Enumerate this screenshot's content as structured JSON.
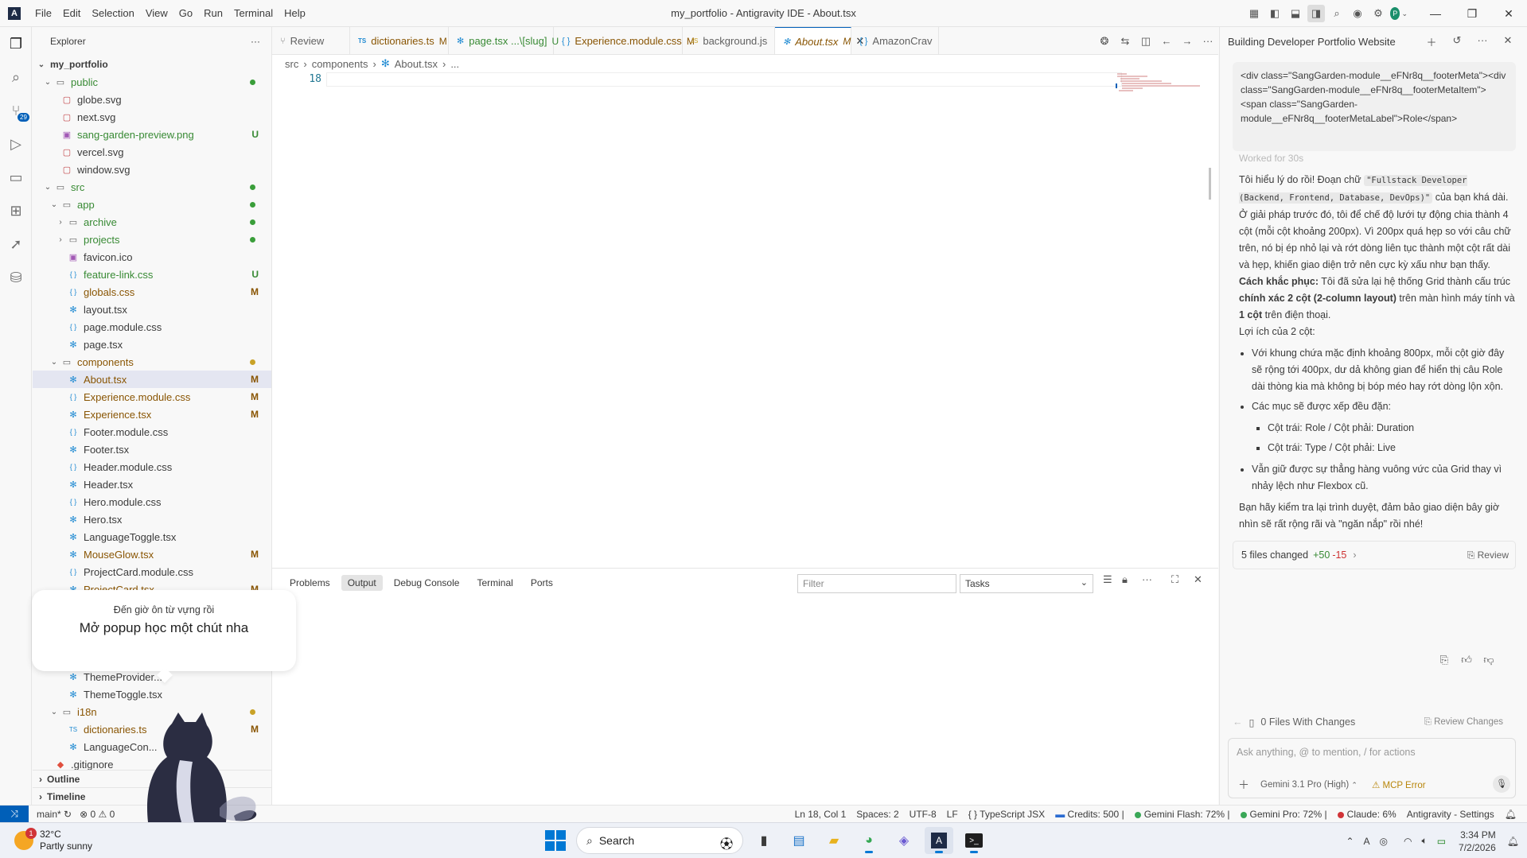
{
  "titlebar": {
    "menu": [
      "File",
      "Edit",
      "Selection",
      "View",
      "Go",
      "Run",
      "Terminal",
      "Help"
    ],
    "title": "my_portfolio - Antigravity IDE - About.tsx",
    "avatar": "P"
  },
  "activity": {
    "scm_badge": "29"
  },
  "explorer": {
    "title": "Explorer",
    "root": "my_portfolio",
    "rows": [
      {
        "name": "public",
        "kind": "folder-open",
        "depth": 1,
        "dot": "#3a9e3a",
        "color": "#388a34"
      },
      {
        "name": "globe.svg",
        "kind": "svg",
        "depth": 2
      },
      {
        "name": "next.svg",
        "kind": "svg",
        "depth": 2
      },
      {
        "name": "sang-garden-preview.png",
        "kind": "png",
        "depth": 2,
        "badge": "U",
        "color": "#388a34"
      },
      {
        "name": "vercel.svg",
        "kind": "svg",
        "depth": 2
      },
      {
        "name": "window.svg",
        "kind": "svg",
        "depth": 2
      },
      {
        "name": "src",
        "kind": "folder-open",
        "depth": 1,
        "dot": "#3a9e3a",
        "color": "#388a34"
      },
      {
        "name": "app",
        "kind": "folder-open",
        "depth": 2,
        "dot": "#3a9e3a",
        "color": "#388a34"
      },
      {
        "name": "archive",
        "kind": "folder",
        "depth": 3,
        "dot": "#3a9e3a",
        "color": "#388a34"
      },
      {
        "name": "projects",
        "kind": "folder",
        "depth": 3,
        "dot": "#3a9e3a",
        "color": "#388a34"
      },
      {
        "name": "favicon.ico",
        "kind": "ico",
        "depth": 3
      },
      {
        "name": "feature-link.css",
        "kind": "css",
        "depth": 3,
        "badge": "U",
        "color": "#388a34"
      },
      {
        "name": "globals.css",
        "kind": "css",
        "depth": 3,
        "badge": "M",
        "color": "#895503"
      },
      {
        "name": "layout.tsx",
        "kind": "tsx",
        "depth": 3
      },
      {
        "name": "page.module.css",
        "kind": "css",
        "depth": 3
      },
      {
        "name": "page.tsx",
        "kind": "tsx",
        "depth": 3
      },
      {
        "name": "components",
        "kind": "folder-open",
        "depth": 2,
        "dot": "#c9a227",
        "color": "#895503"
      },
      {
        "name": "About.tsx",
        "kind": "tsx",
        "depth": 3,
        "badge": "M",
        "color": "#895503",
        "selected": true
      },
      {
        "name": "Experience.module.css",
        "kind": "css",
        "depth": 3,
        "badge": "M",
        "color": "#895503"
      },
      {
        "name": "Experience.tsx",
        "kind": "tsx",
        "depth": 3,
        "badge": "M",
        "color": "#895503"
      },
      {
        "name": "Footer.module.css",
        "kind": "css",
        "depth": 3
      },
      {
        "name": "Footer.tsx",
        "kind": "tsx",
        "depth": 3
      },
      {
        "name": "Header.module.css",
        "kind": "css",
        "depth": 3
      },
      {
        "name": "Header.tsx",
        "kind": "tsx",
        "depth": 3
      },
      {
        "name": "Hero.module.css",
        "kind": "css",
        "depth": 3
      },
      {
        "name": "Hero.tsx",
        "kind": "tsx",
        "depth": 3
      },
      {
        "name": "LanguageToggle.tsx",
        "kind": "tsx",
        "depth": 3
      },
      {
        "name": "MouseGlow.tsx",
        "kind": "tsx",
        "depth": 3,
        "badge": "M",
        "color": "#895503"
      },
      {
        "name": "ProjectCard.module.css",
        "kind": "css",
        "depth": 3
      },
      {
        "name": "ProjectCard.tsx",
        "kind": "tsx",
        "depth": 3,
        "badge": "M",
        "color": "#895503"
      },
      {
        "name": "",
        "kind": "blank",
        "depth": 3
      },
      {
        "name": "",
        "kind": "blank",
        "depth": 3
      },
      {
        "name": "",
        "kind": "blank",
        "depth": 3
      },
      {
        "name": "",
        "kind": "blank",
        "depth": 3
      },
      {
        "name": "ThemeProvider...",
        "kind": "tsx",
        "depth": 3
      },
      {
        "name": "ThemeToggle.tsx",
        "kind": "tsx",
        "depth": 3
      },
      {
        "name": "i18n",
        "kind": "folder-open",
        "depth": 2,
        "dot": "#c9a227",
        "color": "#895503"
      },
      {
        "name": "dictionaries.ts",
        "kind": "ts",
        "depth": 3,
        "badge": "M",
        "color": "#895503"
      },
      {
        "name": "LanguageCon...",
        "kind": "tsx",
        "depth": 3
      },
      {
        "name": ".gitignore",
        "kind": "git",
        "depth": 1
      }
    ],
    "outline": "Outline",
    "timeline": "Timeline"
  },
  "tabs": [
    {
      "label": "Review",
      "icon": "review",
      "mod": "",
      "color": "#616161"
    },
    {
      "label": "dictionaries.ts",
      "icon": "TS",
      "mod": "M",
      "color": "#895503"
    },
    {
      "label": "page.tsx  ...\\[slug]",
      "icon": "react",
      "mod": "U",
      "color": "#388a34"
    },
    {
      "label": "Experience.module.css",
      "icon": "css",
      "mod": "M",
      "color": "#895503"
    },
    {
      "label": "background.js",
      "icon": "JS",
      "mod": "",
      "color": "#616161"
    },
    {
      "label": "About.tsx",
      "icon": "react",
      "mod": "M",
      "color": "#895503",
      "active": true
    },
    {
      "label": "AmazonCrav",
      "icon": "css",
      "mod": "",
      "color": "#616161"
    }
  ],
  "breadcrumb": [
    "src",
    "components",
    "About.tsx",
    "..."
  ],
  "editor": {
    "line": "18"
  },
  "panel": {
    "tabs": [
      "Problems",
      "Output",
      "Debug Console",
      "Terminal",
      "Ports"
    ],
    "active": "Output",
    "filter_placeholder": "Filter",
    "tasks": "Tasks"
  },
  "chat": {
    "title": "Building Developer Portfolio Website",
    "code_snippet": "<div class=\"SangGarden-module__eFNr8q__footerMeta\"><div class=\"SangGarden-module__eFNr8q__footerMetaItem\"><span class=\"SangGarden-module__eFNr8q__footerMetaLabel\">Role</span>",
    "worked": "Worked for 30s",
    "p1_a": "Tôi hiểu lý do rồi! Đoạn chữ ",
    "p1_code": "\"Fullstack Developer (Backend, Frontend, Database, DevOps)\"",
    "p1_b": " của bạn khá dài.",
    "p2": "Ở giải pháp trước đó, tôi để chế độ lưới tự động chia thành 4 cột (mỗi cột khoảng 200px). Vì 200px quá hẹp so với câu chữ trên, nó bị ép nhỏ lại và rớt dòng liên tục thành một cột rất dài và hẹp, khiến giao diện trở nên cực kỳ xấu như bạn thấy.",
    "p3_bold": "Cách khắc phục:",
    "p3_a": " Tôi đã sửa lại hệ thống Grid thành cấu trúc ",
    "p3_bold2": "chính xác 2 cột (2-column layout)",
    "p3_b": " trên màn hình máy tính và ",
    "p3_bold3": "1 cột",
    "p3_c": " trên điện thoại.",
    "p4": "Lợi ích của 2 cột:",
    "li1": "Với khung chứa mặc định khoảng 800px, mỗi cột giờ đây sẽ rộng tới 400px, dư dả không gian để hiển thị câu Role dài thòng kia mà không bị bóp méo hay rớt dòng lộn xộn.",
    "li2": "Các mục sẽ được xếp đều đặn:",
    "li2a": "Cột trái: Role / Cột phải: Duration",
    "li2b": "Cột trái: Type / Cột phải: Live",
    "li3": "Vẫn giữ được sự thẳng hàng vuông vức của Grid thay vì nhảy lệch như Flexbox cũ.",
    "p5": "Bạn hãy kiểm tra lại trình duyệt, đảm bảo giao diện bây giờ nhìn sẽ rất rộng rãi và \"ngăn nắp\" rồi nhé!",
    "changes": "5 files changed",
    "plus": "+50",
    "minus": "-15",
    "review": "Review",
    "files_with_changes": "0 Files With Changes",
    "review_changes": "Review Changes",
    "input_placeholder": "Ask anything, @ to mention, / for actions",
    "model": "Gemini 3.1 Pro (High)",
    "mcp": "MCP Error"
  },
  "statusbar": {
    "branch": "main*",
    "errors": "0",
    "warnings": "0",
    "position": "Ln 18, Col 1",
    "spaces": "Spaces: 2",
    "encoding": "UTF-8",
    "eol": "LF",
    "language": "TypeScript JSX",
    "credits": "Credits: 500 |",
    "gemini_flash": "Gemini Flash: 72% |",
    "gemini_pro": "Gemini Pro: 72% |",
    "claude": "Claude: 6%",
    "settings": "Antigravity - Settings"
  },
  "popup": {
    "line1": "Đến giờ ôn từ vựng rồi",
    "line2": "Mở popup học một chút nha"
  },
  "taskbar": {
    "temp": "32°C",
    "weather": "Partly sunny",
    "weather_badge": "1",
    "search": "Search",
    "time": "3:34 PM",
    "date": "7/2/2026"
  }
}
